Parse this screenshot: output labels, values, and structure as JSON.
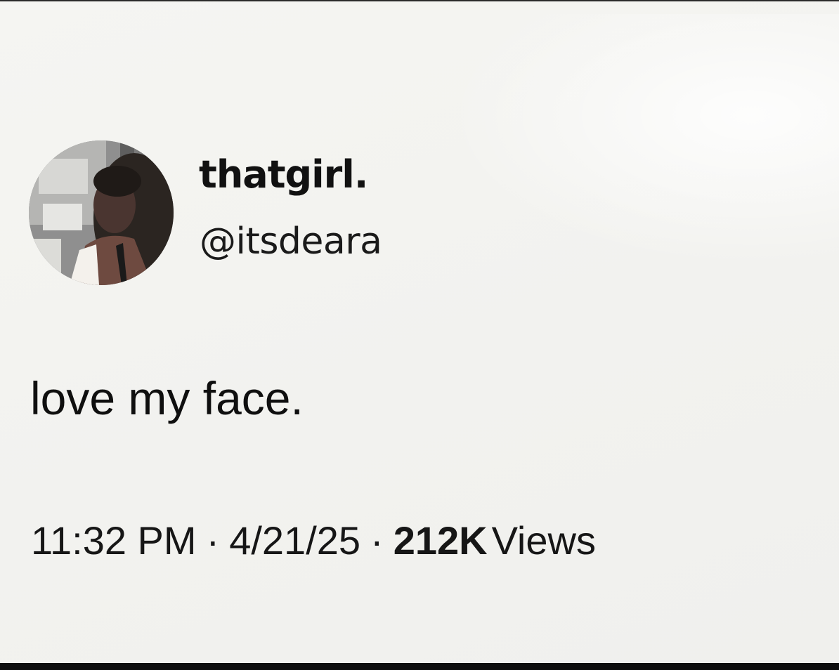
{
  "tweet": {
    "author": {
      "display_name": "thatgirl.",
      "handle": "@itsdeara",
      "avatar_icon": "profile-photo"
    },
    "text": "love my face.",
    "time": "11:32 PM",
    "separator": "·",
    "date": "4/21/25",
    "views_count": "212K",
    "views_label": "Views"
  },
  "colors": {
    "background": "#f3f3f0",
    "text_primary": "#111111",
    "bottom_bar": "#0d0d0d"
  }
}
